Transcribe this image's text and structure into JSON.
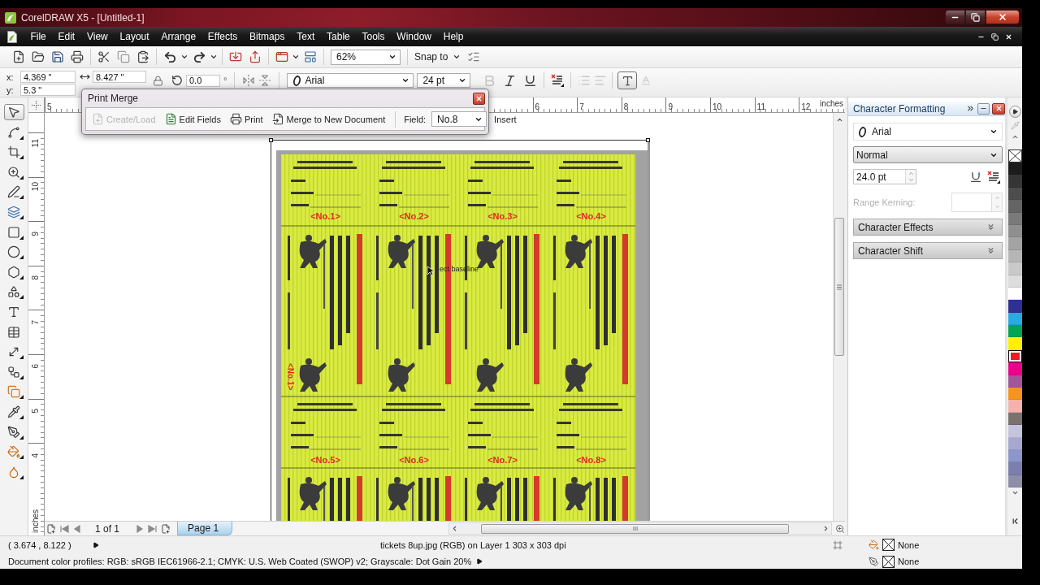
{
  "window": {
    "title": "CorelDRAW X5 - [Untitled-1]"
  },
  "menu": [
    "File",
    "Edit",
    "View",
    "Layout",
    "Arrange",
    "Effects",
    "Bitmaps",
    "Text",
    "Table",
    "Tools",
    "Window",
    "Help"
  ],
  "standard_toolbar": {
    "zoom": "62%",
    "snap": "Snap to"
  },
  "property_bar": {
    "x_label": "x:",
    "x_value": "4.369 \"",
    "y_label": "y:",
    "y_value": "5.3 \"",
    "width_value": "8.427 \"",
    "rotation_value": "0.0",
    "rotation_unit": "°",
    "font": "Arial",
    "font_size": "24 pt",
    "format_buttons": [
      {
        "kind": "bold",
        "disabled": true
      },
      {
        "kind": "italic",
        "disabled": false
      },
      {
        "kind": "underline",
        "disabled": false
      }
    ],
    "frame_toggle": {
      "selected": true
    }
  },
  "print_merge": {
    "title": "Print Merge",
    "actions": [
      {
        "kind": "create",
        "label": "Create/Load",
        "disabled": true
      },
      {
        "kind": "edit",
        "label": "Edit Fields",
        "disabled": false
      },
      {
        "kind": "print",
        "label": "Print",
        "disabled": false
      },
      {
        "kind": "merge",
        "label": "Merge to New Document",
        "disabled": false
      }
    ],
    "field_label": "Field:",
    "field_value": "No.8",
    "insert": "Insert"
  },
  "rulers": {
    "horizontal": {
      "start_label": "5",
      "labels": [
        "6",
        "7",
        "8",
        "9",
        "10",
        "11",
        "12"
      ],
      "unit": "inches"
    },
    "vertical": {
      "labels": [
        "11",
        "10",
        "9",
        "8",
        "7",
        "6",
        "5",
        "4"
      ],
      "unit": "inches"
    }
  },
  "toolbox": [
    {
      "kind": "pick",
      "selected": true
    },
    {
      "kind": "shape",
      "selected": false
    },
    {
      "kind": "crop",
      "selected": false
    },
    {
      "kind": "zoom",
      "selected": false
    },
    {
      "kind": "freehand",
      "selected": false
    },
    {
      "kind": "smartfill",
      "selected": false
    },
    {
      "kind": "rectangle",
      "selected": false
    },
    {
      "kind": "ellipse",
      "selected": false
    },
    {
      "kind": "polygon",
      "selected": false
    },
    {
      "kind": "shapes",
      "selected": false
    },
    {
      "kind": "text",
      "selected": false
    },
    {
      "kind": "table",
      "selected": false
    },
    {
      "kind": "dimension",
      "selected": false
    },
    {
      "kind": "connector",
      "selected": false
    },
    {
      "kind": "blend",
      "selected": false
    },
    {
      "kind": "eyedropper",
      "selected": false
    },
    {
      "kind": "outline",
      "selected": false
    },
    {
      "kind": "fill",
      "selected": false
    },
    {
      "kind": "interactivefill",
      "selected": false
    }
  ],
  "canvas": {
    "stub_fields": [
      "<No.1>",
      "<No.2>",
      "<No.3>",
      "<No.4>",
      "<No.5>",
      "<No.6>",
      "<No.7>",
      "<No.8>"
    ],
    "rotated_fields": [
      "<No.1>"
    ],
    "cursor_hint": "ect baseline"
  },
  "docker": {
    "title": "Character Formatting",
    "font": "Arial",
    "style": "Normal",
    "size": "24.0 pt",
    "kerning": {
      "label": "Range Kerning:",
      "disabled": true
    },
    "sections": [
      {
        "label": "Character Effects",
        "expanded": false
      },
      {
        "label": "Character Shift",
        "expanded": false
      }
    ]
  },
  "palette": [
    {
      "color": "#1c1c1c",
      "selected": false
    },
    {
      "color": "#353535",
      "selected": false
    },
    {
      "color": "#4d4d4d",
      "selected": false
    },
    {
      "color": "#646464",
      "selected": false
    },
    {
      "color": "#7a7a7a",
      "selected": false
    },
    {
      "color": "#8f8f8f",
      "selected": false
    },
    {
      "color": "#a3a3a3",
      "selected": false
    },
    {
      "color": "#b6b6b6",
      "selected": false
    },
    {
      "color": "#c9c9c9",
      "selected": false
    },
    {
      "color": "#dddddd",
      "selected": false
    },
    {
      "color": "#ffffff",
      "selected": false
    },
    {
      "color": "#2e3192",
      "selected": false
    },
    {
      "color": "#29abe2",
      "selected": false
    },
    {
      "color": "#00a651",
      "selected": false
    },
    {
      "color": "#fff200",
      "selected": false
    },
    {
      "color": "#ed1c24",
      "selected": true
    },
    {
      "color": "#ec008c",
      "selected": false
    },
    {
      "color": "#a3569a",
      "selected": false
    },
    {
      "color": "#f7941d",
      "selected": false
    },
    {
      "color": "#f5b2ac",
      "selected": false
    },
    {
      "color": "#7a726d",
      "selected": false
    },
    {
      "color": "#c4c4df",
      "selected": false
    },
    {
      "color": "#a7a7cf",
      "selected": false
    },
    {
      "color": "#8a97c9",
      "selected": false
    },
    {
      "color": "#7c7fae",
      "selected": false
    },
    {
      "color": "#8e8ea8",
      "selected": false
    }
  ],
  "page_nav": {
    "counter": "1 of 1",
    "tabs": [
      {
        "label": "Page 1",
        "selected": true
      }
    ]
  },
  "status_bar": {
    "cursor_position": "( 3.674 , 8.122 )",
    "selection_info": "tickets 8up.jpg (RGB) on Layer 1 303 x 303 dpi",
    "color_profiles": "Document color profiles: RGB: sRGB IEC61966-2.1; CMYK: U.S. Web Coated (SWOP) v2; Grayscale: Dot Gain 20%",
    "fill": "None",
    "outline": "None"
  }
}
